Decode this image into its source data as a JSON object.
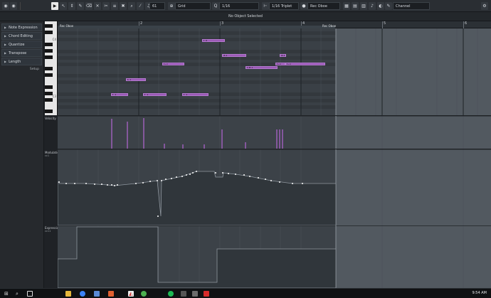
{
  "toolbar": {
    "quantize_value": "61",
    "grid_type": "Grid",
    "quantize_preset": "1/16",
    "length_quantize": "1/16 Triplet",
    "track_name": "Rec Oboe",
    "midi_channel": "Channel"
  },
  "info_line": "No Object Selected",
  "inspector": {
    "sections": [
      "Note Expression",
      "Chord Editing",
      "Quantize",
      "Transpose",
      "Length"
    ],
    "setup_label": "Setup"
  },
  "keyboard": {
    "labels": [
      "C4",
      "C3"
    ]
  },
  "ruler": {
    "bars": [
      "2",
      "3",
      "4",
      "5",
      "6"
    ],
    "region_start_label": "Rec Oboe",
    "region_end_label": "Rec Oboe"
  },
  "notes": [
    {
      "label": "C4"
    },
    {
      "label": "A3"
    },
    {
      "label": "A3"
    },
    {
      "label": "G3"
    },
    {
      "label": "F#3"
    },
    {
      "label": "G3"
    },
    {
      "label": "G3"
    },
    {
      "label": "E3"
    },
    {
      "label": "C3"
    },
    {
      "label": "C3"
    },
    {
      "label": "C3"
    }
  ],
  "lanes": {
    "velocity": {
      "label": "Velocity"
    },
    "modulation": {
      "label": "Modulation",
      "sub": "cc1"
    },
    "expression": {
      "label": "Expression",
      "sub": "cc11"
    }
  },
  "taskbar": {
    "time": "9:54 AM"
  },
  "colors": {
    "note": "#9b59b6",
    "accent": "#ffffff",
    "taskbar_red": "#d62b2b"
  }
}
